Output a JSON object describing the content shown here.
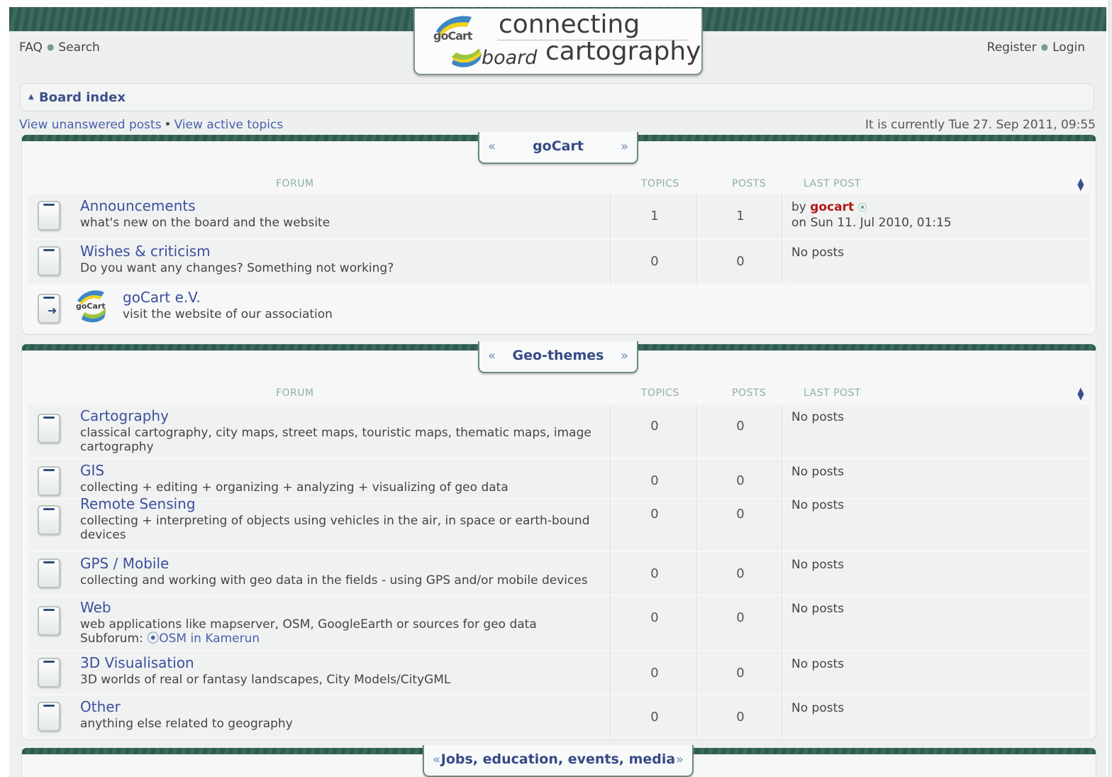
{
  "header": {
    "logo_word": "goCart",
    "tagline_line1": "connecting",
    "tagline_board": "board",
    "tagline_line2": "cartography",
    "left_links": [
      "FAQ",
      "Search"
    ],
    "right_links": [
      "Register",
      "Login"
    ]
  },
  "breadcrumb": {
    "label": "Board index"
  },
  "navbar": {
    "unanswered": "View unanswered posts",
    "separator": "•",
    "active": "View active topics",
    "current_time": "It is currently Tue 27. Sep 2011, 09:55"
  },
  "columns": {
    "forum": "FORUM",
    "topics": "TOPICS",
    "posts": "POSTS",
    "last_post": "LAST POST"
  },
  "categories": [
    {
      "title": "goCart",
      "forums": [
        {
          "title": "Announcements",
          "description": "what's new on the board and the website",
          "topics": "1",
          "posts": "1",
          "last_by": "by",
          "last_author": "gocart",
          "last_on": "on Sun 11. Jul 2010, 01:15"
        },
        {
          "title": "Wishes & criticism",
          "description": "Do you want any changes? Something not working?",
          "topics": "0",
          "posts": "0",
          "last_post": "No posts"
        },
        {
          "title": "goCart e.V.",
          "description": "visit the website of our association",
          "type": "link"
        }
      ]
    },
    {
      "title": "Geo-themes",
      "forums": [
        {
          "title": "Cartography",
          "description": "classical cartography, city maps, street maps, touristic maps, thematic maps, image cartography",
          "topics": "0",
          "posts": "0",
          "last_post": "No posts"
        },
        {
          "title": "GIS",
          "description": "collecting + editing + organizing + analyzing + visualizing of geo data",
          "topics": "0",
          "posts": "0",
          "last_post": "No posts"
        },
        {
          "title": "Remote Sensing",
          "description": "collecting + interpreting of objects using vehicles in the air, in space or earth-bound devices",
          "topics": "0",
          "posts": "0",
          "last_post": "No posts"
        },
        {
          "title": "GPS / Mobile",
          "description": "collecting and working with geo data in the fields - using GPS and/or mobile devices",
          "topics": "0",
          "posts": "0",
          "last_post": "No posts"
        },
        {
          "title": "Web",
          "description": "web applications like mapserver, OSM, GoogleEarth or sources for geo data",
          "subforum_label": "Subforum:",
          "subforum_link": "OSM in Kamerun",
          "topics": "0",
          "posts": "0",
          "last_post": "No posts"
        },
        {
          "title": "3D Visualisation",
          "description": "3D worlds of real or fantasy landscapes, City Models/CityGML",
          "topics": "0",
          "posts": "0",
          "last_post": "No posts"
        },
        {
          "title": "Other",
          "description": "anything else related to geography",
          "topics": "0",
          "posts": "0",
          "last_post": "No posts"
        }
      ]
    },
    {
      "title": "Jobs, education, events, media"
    }
  ],
  "colors": {
    "accent": "#3d4f8c",
    "band": "#2f5a4f",
    "author": "#b21818"
  }
}
